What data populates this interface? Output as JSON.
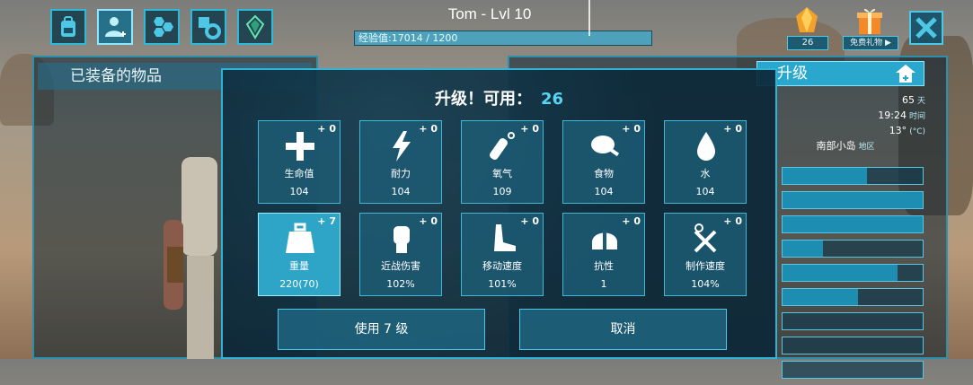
{
  "top": {
    "player_name": "Tom - Lvl 10",
    "xp_label": "经验值:17014 / 1200",
    "xp_fraction": 1.0,
    "gems_count": "26",
    "gift_label": "免费礼物 ▶"
  },
  "equip_panel": {
    "title": "已装备的物品"
  },
  "stats_panel": {
    "upgrade_label": "升级",
    "day_value": "65",
    "day_unit": "天",
    "time_value": "19:24",
    "time_unit": "时间",
    "temp_value": "13°",
    "temp_unit": "(°C)",
    "location_value": "南部小岛",
    "location_unit": "地区",
    "bars": [
      0.6,
      1.0,
      1.0,
      0.29,
      0.82,
      0.54,
      0.0,
      0.0,
      0.0
    ]
  },
  "modal": {
    "title": "升级！可用：",
    "available": "26",
    "stats": [
      {
        "icon": "health-cross-icon",
        "plus": "+ 0",
        "name": "生命值",
        "value": "104"
      },
      {
        "icon": "stamina-bolt-icon",
        "plus": "+ 0",
        "name": "耐力",
        "value": "104"
      },
      {
        "icon": "oxygen-tank-icon",
        "plus": "+ 0",
        "name": "氧气",
        "value": "109"
      },
      {
        "icon": "food-meat-icon",
        "plus": "+ 0",
        "name": "食物",
        "value": "104"
      },
      {
        "icon": "water-drop-icon",
        "plus": "+ 0",
        "name": "水",
        "value": "104"
      },
      {
        "icon": "weight-icon",
        "plus": "+ 7",
        "name": "重量",
        "value": "220(70)"
      },
      {
        "icon": "melee-fist-icon",
        "plus": "+ 0",
        "name": "近战伤害",
        "value": "102%"
      },
      {
        "icon": "movement-foot-icon",
        "plus": "+ 0",
        "name": "移动速度",
        "value": "101%"
      },
      {
        "icon": "fortitude-helmet-icon",
        "plus": "+ 0",
        "name": "抗性",
        "value": "1"
      },
      {
        "icon": "crafting-tools-icon",
        "plus": "+ 0",
        "name": "制作速度",
        "value": "104%"
      }
    ],
    "confirm_label": "使用 7 级",
    "cancel_label": "取消"
  },
  "colors": {
    "accent": "#2fb3d6",
    "selected": "#2ea5c7",
    "panel": "#1c5c74"
  }
}
